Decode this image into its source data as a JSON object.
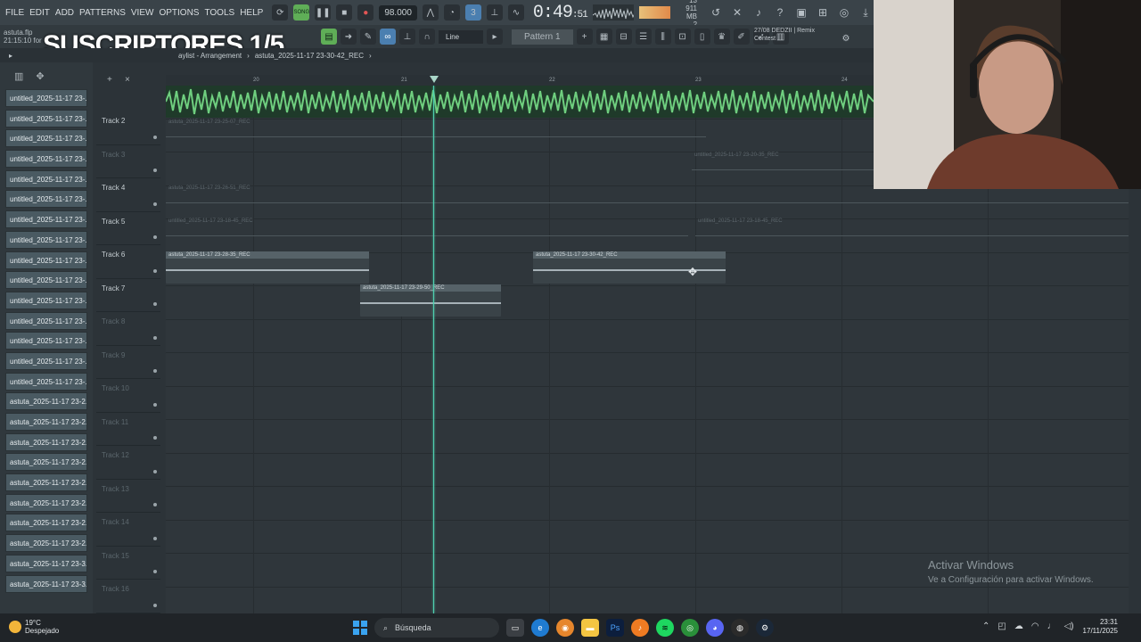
{
  "menu": [
    "FILE",
    "EDIT",
    "ADD",
    "PATTERNS",
    "VIEW",
    "OPTIONS",
    "TOOLS",
    "HELP"
  ],
  "transport": {
    "song_label": "SONG",
    "tempo": "98.000",
    "time_main": "0:49",
    "time_sub": ":51",
    "cpu_top": "13",
    "mem": "911 MB",
    "cpu_bottom": "2"
  },
  "project": {
    "filename": "astuta.flp",
    "time_info": "21:15:10 for"
  },
  "overlay": {
    "title": "SUSCRIPTORES 1/5"
  },
  "toolbar2": {
    "snap": "Line",
    "pattern": "Pattern 1"
  },
  "news": {
    "line1": "27/08  DEDZII | Remix",
    "line2": "Contest"
  },
  "playlist": {
    "breadcrumb": "aylist - Arrangement",
    "current_clip": "astuta_2025-11-17 23-30-42_REC"
  },
  "ruler": [
    "20",
    "21",
    "22",
    "23",
    "24"
  ],
  "browser_clips": [
    "untitled_2025-11-17 23-...",
    "untitled_2025-11-17 23-...",
    "untitled_2025-11-17 23-...",
    "untitled_2025-11-17 23-...",
    "untitled_2025-11-17 23-...",
    "untitled_2025-11-17 23-...",
    "untitled_2025-11-17 23-...",
    "untitled_2025-11-17 23-...",
    "untitled_2025-11-17 23-...",
    "untitled_2025-11-17 23-...",
    "untitled_2025-11-17 23-...",
    "untitled_2025-11-17 23-...",
    "untitled_2025-11-17 23-...",
    "untitled_2025-11-17 23-...",
    "untitled_2025-11-17 23-...",
    "astuta_2025-11-17 23-2...",
    "astuta_2025-11-17 23-2...",
    "astuta_2025-11-17 23-2...",
    "astuta_2025-11-17 23-2...",
    "astuta_2025-11-17 23-2...",
    "astuta_2025-11-17 23-2...",
    "astuta_2025-11-17 23-2...",
    "astuta_2025-11-17 23-2...",
    "astuta_2025-11-17 23-3...",
    "astuta_2025-11-17 23-3..."
  ],
  "tracks": [
    {
      "name": "Track 2",
      "dim": false
    },
    {
      "name": "Track 3",
      "dim": true
    },
    {
      "name": "Track 4",
      "dim": false
    },
    {
      "name": "Track 5",
      "dim": false
    },
    {
      "name": "Track 6",
      "dim": false
    },
    {
      "name": "Track 7",
      "dim": false
    },
    {
      "name": "Track 8",
      "dim": true
    },
    {
      "name": "Track 9",
      "dim": true
    },
    {
      "name": "Track 10",
      "dim": true
    },
    {
      "name": "Track 11",
      "dim": true
    },
    {
      "name": "Track 12",
      "dim": true
    },
    {
      "name": "Track 13",
      "dim": true
    },
    {
      "name": "Track 14",
      "dim": true
    },
    {
      "name": "Track 15",
      "dim": true
    },
    {
      "name": "Track 16",
      "dim": true
    }
  ],
  "clips": {
    "t2": "astuta_2025-11-17 23-25-07_REC",
    "t3": "untitled_2025-11-17 23-20-35_REC",
    "t4": "astuta_2025-11-17 23-26-51_REC",
    "t5a": "untitled_2025-11-17 23-18-45_REC",
    "t5b": "untitled_2025-11-17 23-18-45_REC",
    "t6a": "astuta_2025-11-17 23-28-35_REC",
    "t6b": "astuta_2025-11-17 23-30-42_REC",
    "t7": "astuta_2025-11-17 23-29-50_REC"
  },
  "watermark": {
    "line1": "Activar Windows",
    "line2": "Ve a Configuración para activar Windows."
  },
  "taskbar": {
    "temp": "19°C",
    "weather": "Despejado",
    "search": "Búsqueda",
    "time": "23:31",
    "date": "17/11/2025"
  },
  "colors": {
    "accent_green": "#5fae57",
    "playhead": "#4fd0b0",
    "audio_wave": "#6fcf7f"
  }
}
